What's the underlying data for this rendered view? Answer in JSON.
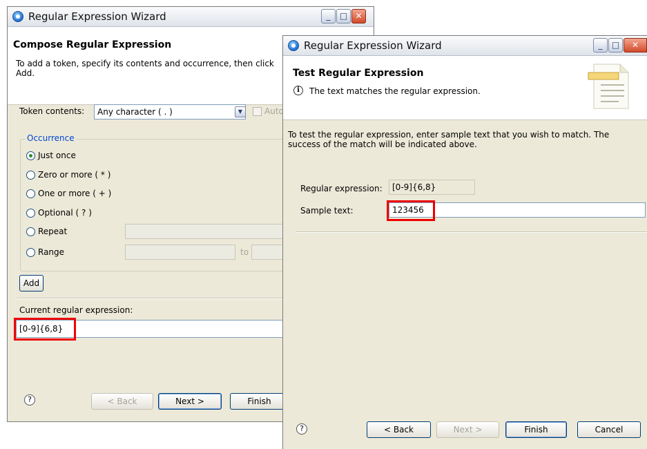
{
  "window1": {
    "title": "Regular Expression Wizard",
    "header_title": "Compose Regular Expression",
    "header_desc": "To add a token, specify its contents and occurrence, then click Add.",
    "token_label": "Token contents:",
    "token_value": "Any character ( . )",
    "auto_label": "Auto",
    "occurrence_legend": "Occurrence",
    "radios": [
      "Just once",
      "Zero or more ( * )",
      "One or more ( + )",
      "Optional ( ? )",
      "Repeat",
      "Range"
    ],
    "range_to": "to",
    "add_label": "Add",
    "current_label": "Current regular expression:",
    "current_value": "[0-9]{6,8}",
    "back_label": "< Back",
    "next_label": "Next >",
    "finish_label": "Finish"
  },
  "window2": {
    "title": "Regular Expression Wizard",
    "header_title": "Test Regular Expression",
    "header_msg": "The text matches the regular expression.",
    "desc": "To test the regular expression, enter sample text that you wish to match.  The success of the match will be indicated above.",
    "regex_label": "Regular expression:",
    "regex_value": "[0-9]{6,8}",
    "sample_label": "Sample text:",
    "sample_value": "123456",
    "back_label": "< Back",
    "next_label": "Next >",
    "finish_label": "Finish",
    "cancel_label": "Cancel"
  },
  "icons": {
    "help": "?",
    "info": "i",
    "minimize": "_",
    "maximize": "□",
    "close": "✕",
    "dropdown": "▼"
  },
  "colors": {
    "highlight": "#ee0000",
    "dialog_bg": "#ece9d8",
    "legend_text": "#0046d5"
  }
}
